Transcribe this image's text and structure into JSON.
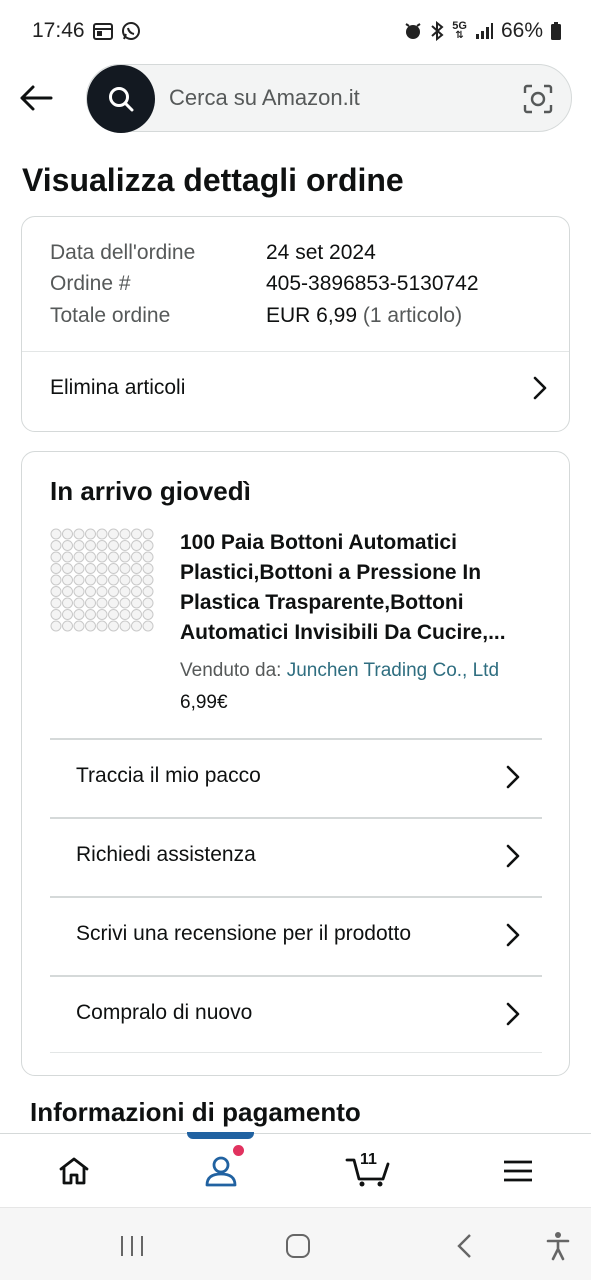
{
  "status_bar": {
    "time": "17:46",
    "network": "5G",
    "battery": "66%"
  },
  "header": {
    "search_placeholder": "Cerca su Amazon.it"
  },
  "page_title": "Visualizza dettagli ordine",
  "order_summary": {
    "date_label": "Data dell'ordine",
    "date_value": "24 set 2024",
    "order_label": "Ordine #",
    "order_value": "405-3896853-5130742",
    "total_label": "Totale ordine",
    "total_value": "EUR 6,99",
    "total_items": "(1 articolo)",
    "delete_items_label": "Elimina articoli"
  },
  "delivery": {
    "title": "In arrivo giovedì",
    "product_title": "100 Paia Bottoni Automatici Plastici,Bottoni a Pressione In Plastica Trasparente,Bottoni Automatici Invisibili Da Cucire,...",
    "seller_label": "Venduto da:",
    "seller_name": "Junchen Trading Co., Ltd",
    "price": "6,99€",
    "actions": [
      {
        "label": "Traccia il mio pacco"
      },
      {
        "label": "Richiedi assistenza"
      },
      {
        "label": "Scrivi una recensione per il prodotto"
      },
      {
        "label": "Compralo di nuovo"
      }
    ]
  },
  "payment_title": "Informazioni di pagamento",
  "bottom_nav": {
    "cart_count": "11",
    "accent_color": "#2162a1"
  }
}
